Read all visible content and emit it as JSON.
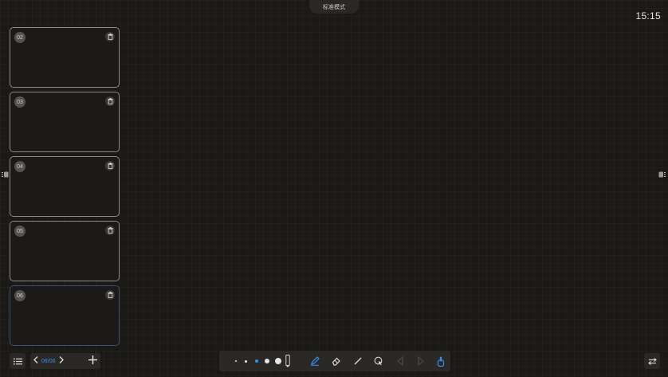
{
  "header": {
    "mode_label": "标准模式",
    "clock": "15:15"
  },
  "pages": [
    {
      "number": "02",
      "active": false
    },
    {
      "number": "03",
      "active": false
    },
    {
      "number": "04",
      "active": false
    },
    {
      "number": "05",
      "active": false
    },
    {
      "number": "06",
      "active": true
    }
  ],
  "pager": {
    "current": "06/06"
  },
  "toolbar": {
    "pen_sizes": 5,
    "selected_size_index": 2,
    "accent_color": "#3a8ef0",
    "tools": [
      "pen-icon",
      "eraser-icon",
      "line-icon",
      "lasso-select-icon",
      "undo-icon",
      "redo-icon",
      "touch-hand-icon"
    ]
  },
  "colors": {
    "background": "#1b1915",
    "panel": "#2b2926",
    "accent": "#3a8ef0"
  }
}
